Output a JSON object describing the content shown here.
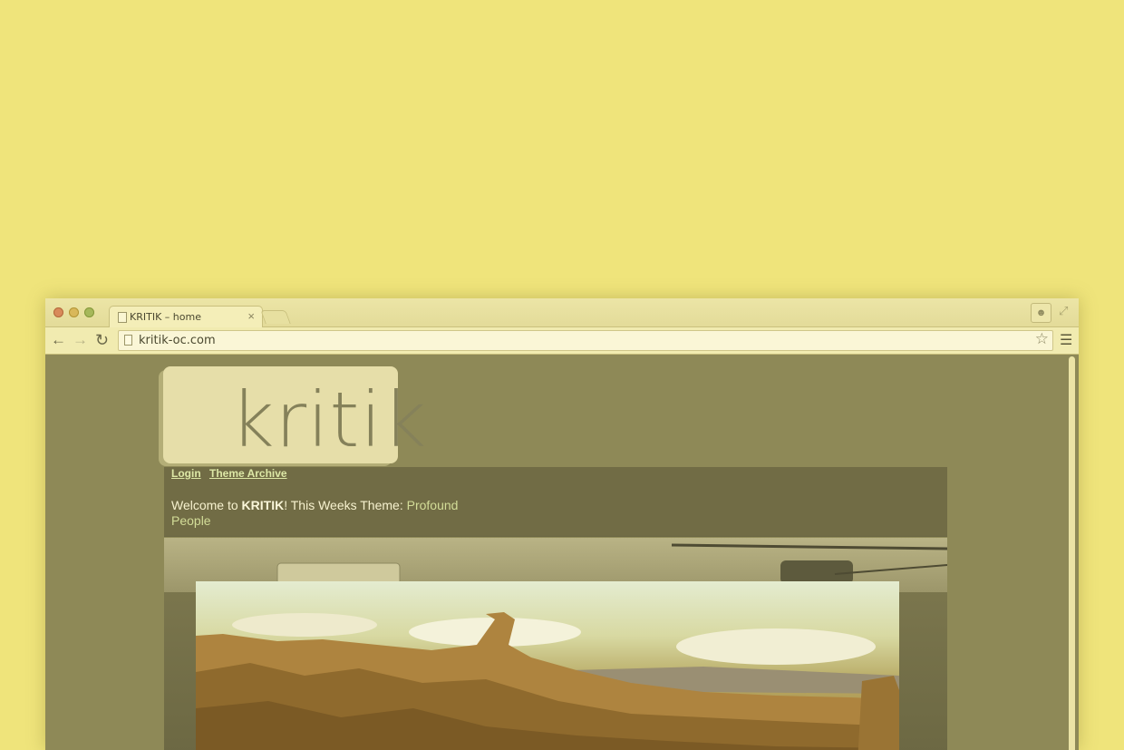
{
  "window": {
    "tab_title": "KRITIK – home",
    "tab_close": "×",
    "url": "kritik-oc.com"
  },
  "icons": {
    "back": "arrow-left-icon",
    "forward": "arrow-right-icon",
    "reload": "reload-icon",
    "bookmark": "star-icon",
    "menu": "hamburger-menu-icon",
    "profile": "person-icon",
    "fullscreen": "expand-icon"
  },
  "site": {
    "logo": "kritik",
    "nav": [
      "Login",
      "Theme Archive"
    ],
    "welcome_prefix": "Welcome to ",
    "brand": "KRITIK",
    "welcome_suffix": "! This Weeks Theme: ",
    "theme_name": "Profound People"
  },
  "colors": {
    "background": "#efe47b",
    "page": "#8e8957",
    "header_band": "#716c45",
    "link": "#dde8a6"
  }
}
